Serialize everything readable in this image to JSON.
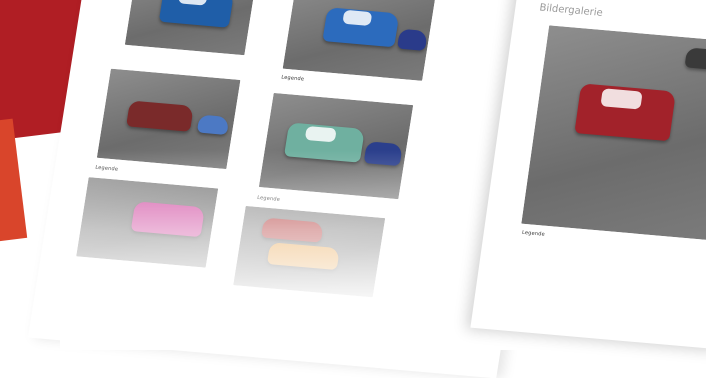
{
  "gallery": {
    "title": "Bildergalerie",
    "caption": "Legende"
  },
  "colors": {
    "accent_red": "#b01e24",
    "accent_orange": "#d9452b",
    "car_blue": "#1f5ea8",
    "car_red": "#a2222a",
    "car_teal": "#6fb0a0",
    "car_maroon": "#7a2a2a"
  },
  "thumbnails": [
    {
      "caption": "Legende"
    },
    {
      "caption": "Legende"
    },
    {
      "caption": "Legende"
    },
    {
      "caption": "Legende"
    }
  ]
}
